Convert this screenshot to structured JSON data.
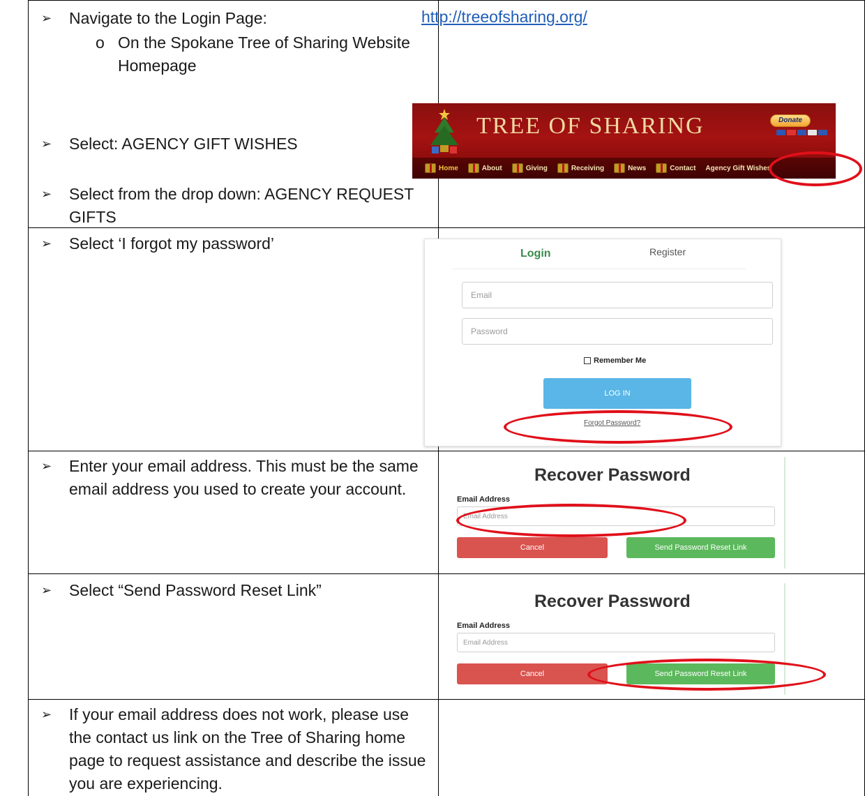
{
  "rows": [
    {
      "step": "Navigate to the Login Page:",
      "substep": "On the Spokane Tree of Sharing Website Homepage",
      "bullet": "o",
      "url": "http://treeofsharing.org/",
      "step2": "Select: AGENCY GIFT WISHES",
      "step3": "Select from the drop down: AGENCY REQUEST GIFTS"
    },
    {
      "step": "Select ‘I forgot my password’"
    },
    {
      "step": "Enter your email address. This must be the same email address you used to create your account."
    },
    {
      "step": "Select “Send Password Reset Link”"
    },
    {
      "step": "If your email address does not work, please use the contact us link on the Tree of Sharing home page to request assistance and describe the issue you are experiencing."
    }
  ],
  "arrow_glyph": "➢",
  "banner": {
    "title": "TREE OF SHARING",
    "donate_label": "Donate",
    "nav": [
      "Home",
      "About",
      "Giving",
      "Receiving",
      "News",
      "Contact",
      "Agency Gift Wishes"
    ]
  },
  "login": {
    "tab_login": "Login",
    "tab_register": "Register",
    "email_placeholder": "Email",
    "password_placeholder": "Password",
    "remember_label": "Remember Me",
    "login_button": "LOG IN",
    "forgot_link": "Forgot Password?"
  },
  "recover": {
    "title": "Recover Password",
    "email_label": "Email Address",
    "email_placeholder": "Email Address",
    "cancel_label": "Cancel",
    "send_label": "Send Password Reset Link"
  },
  "colors": {
    "annotation": "#e0101a",
    "link": "#1f5db8",
    "banner_red": "#a51212",
    "login_blue": "#5ab6e6",
    "cancel_red": "#d9534f",
    "send_green": "#5cb85c"
  }
}
